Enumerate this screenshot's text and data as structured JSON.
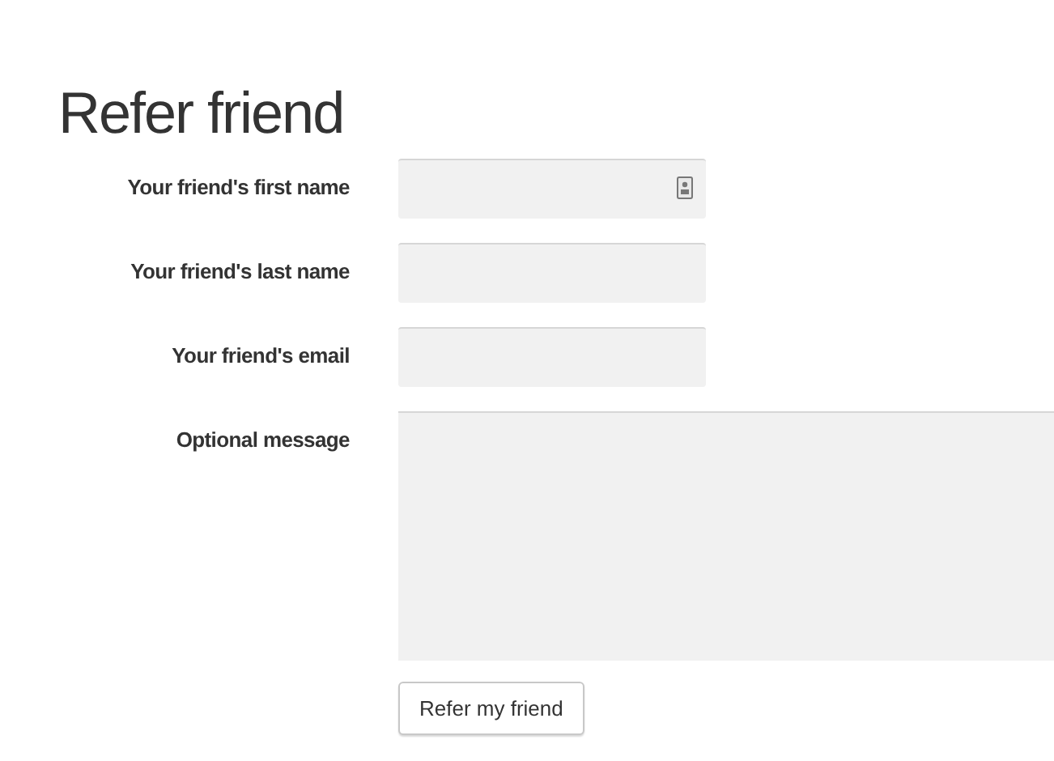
{
  "title": "Refer friend",
  "fields": [
    {
      "label": "Your friend's first name",
      "kind": "input",
      "contact_icon": true
    },
    {
      "label": "Your friend's last name",
      "kind": "input",
      "contact_icon": false
    },
    {
      "label": "Your friend's email",
      "kind": "input",
      "contact_icon": false
    },
    {
      "label": "Optional message",
      "kind": "textarea",
      "contact_icon": false
    }
  ],
  "submit_button": "Refer my friend"
}
